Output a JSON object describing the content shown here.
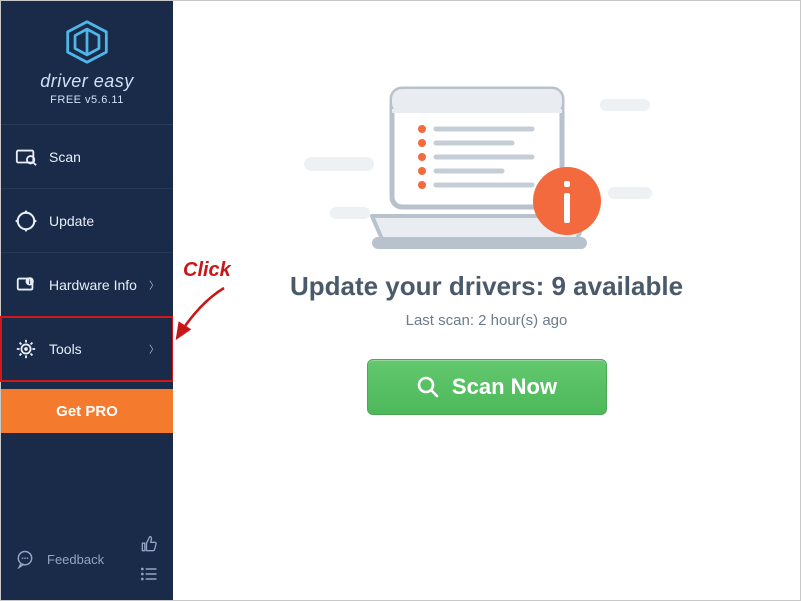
{
  "app": {
    "name": "driver easy",
    "edition": "FREE v5.6.11"
  },
  "sidebar": {
    "items": [
      {
        "label": "Scan",
        "icon": "scan-icon",
        "chevron": false
      },
      {
        "label": "Update",
        "icon": "update-icon",
        "chevron": false
      },
      {
        "label": "Hardware Info",
        "icon": "hardware-info-icon",
        "chevron": true
      },
      {
        "label": "Tools",
        "icon": "tools-icon",
        "chevron": true
      }
    ],
    "get_pro_label": "Get PRO",
    "feedback_label": "Feedback"
  },
  "main": {
    "headline_prefix": "Update your drivers: ",
    "headline_count": "9",
    "headline_suffix": " available",
    "last_scan": "Last scan: 2 hour(s) ago",
    "scan_label": "Scan Now"
  },
  "annotation": {
    "click_label": "Click"
  }
}
